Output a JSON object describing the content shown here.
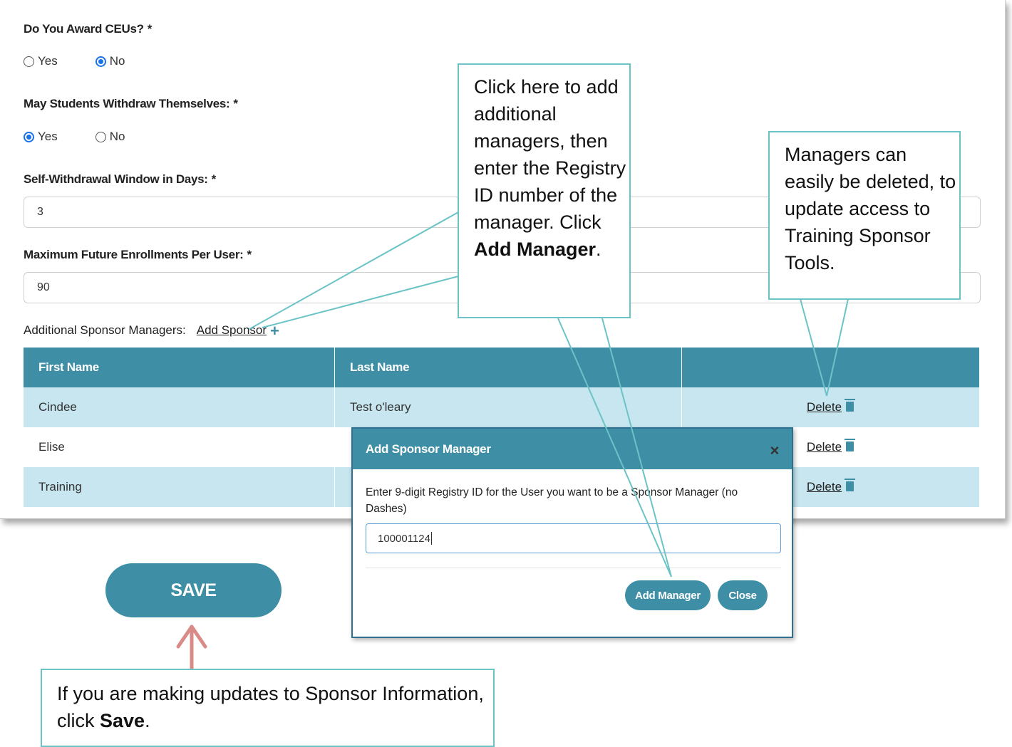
{
  "form": {
    "ceus": {
      "label": "Do You Award CEUs?",
      "required": "*",
      "options": [
        "Yes",
        "No"
      ],
      "selected": "No"
    },
    "withdraw": {
      "label": "May Students Withdraw Themselves:",
      "required": "*",
      "options": [
        "Yes",
        "No"
      ],
      "selected": "Yes"
    },
    "window": {
      "label": "Self-Withdrawal Window in Days:",
      "required": "*",
      "value": "3"
    },
    "max_enroll": {
      "label": "Maximum Future Enrollments Per User:",
      "required": "*",
      "value": "90"
    },
    "additional": {
      "label": "Additional Sponsor Managers:",
      "link": "Add Sponsor",
      "plus": "+"
    }
  },
  "table": {
    "headers": [
      "First Name",
      "Last Name",
      ""
    ],
    "rows": [
      {
        "first": "Cindee",
        "last": "Test o'leary",
        "action": "Delete"
      },
      {
        "first": "Elise",
        "last": "",
        "action": "Delete"
      },
      {
        "first": "Training",
        "last": "",
        "action": "Delete"
      }
    ]
  },
  "save_label": "SAVE",
  "modal": {
    "title": "Add Sponsor Manager",
    "close_glyph": "×",
    "instruction": "Enter 9-digit Registry ID for the User you want to be a Sponsor Manager (no Dashes)",
    "input_value": "100001124",
    "add_button": "Add Manager",
    "close_button": "Close"
  },
  "callouts": {
    "add": {
      "text": "Click here to add additional managers, then enter the Registry ID number of the manager. Click ",
      "bold": "Add Manager",
      "end": "."
    },
    "delete": {
      "text": "Managers can easily be deleted, to update access to Training Sponsor Tools."
    },
    "save": {
      "text": "If you are making updates to Sponsor Information, click ",
      "bold": "Save",
      "end": "."
    }
  },
  "colors": {
    "accent": "#3e8ea5",
    "row_alt": "#c7e6ef",
    "callout_border": "#6cc3c6",
    "arrow": "#d98b88"
  }
}
